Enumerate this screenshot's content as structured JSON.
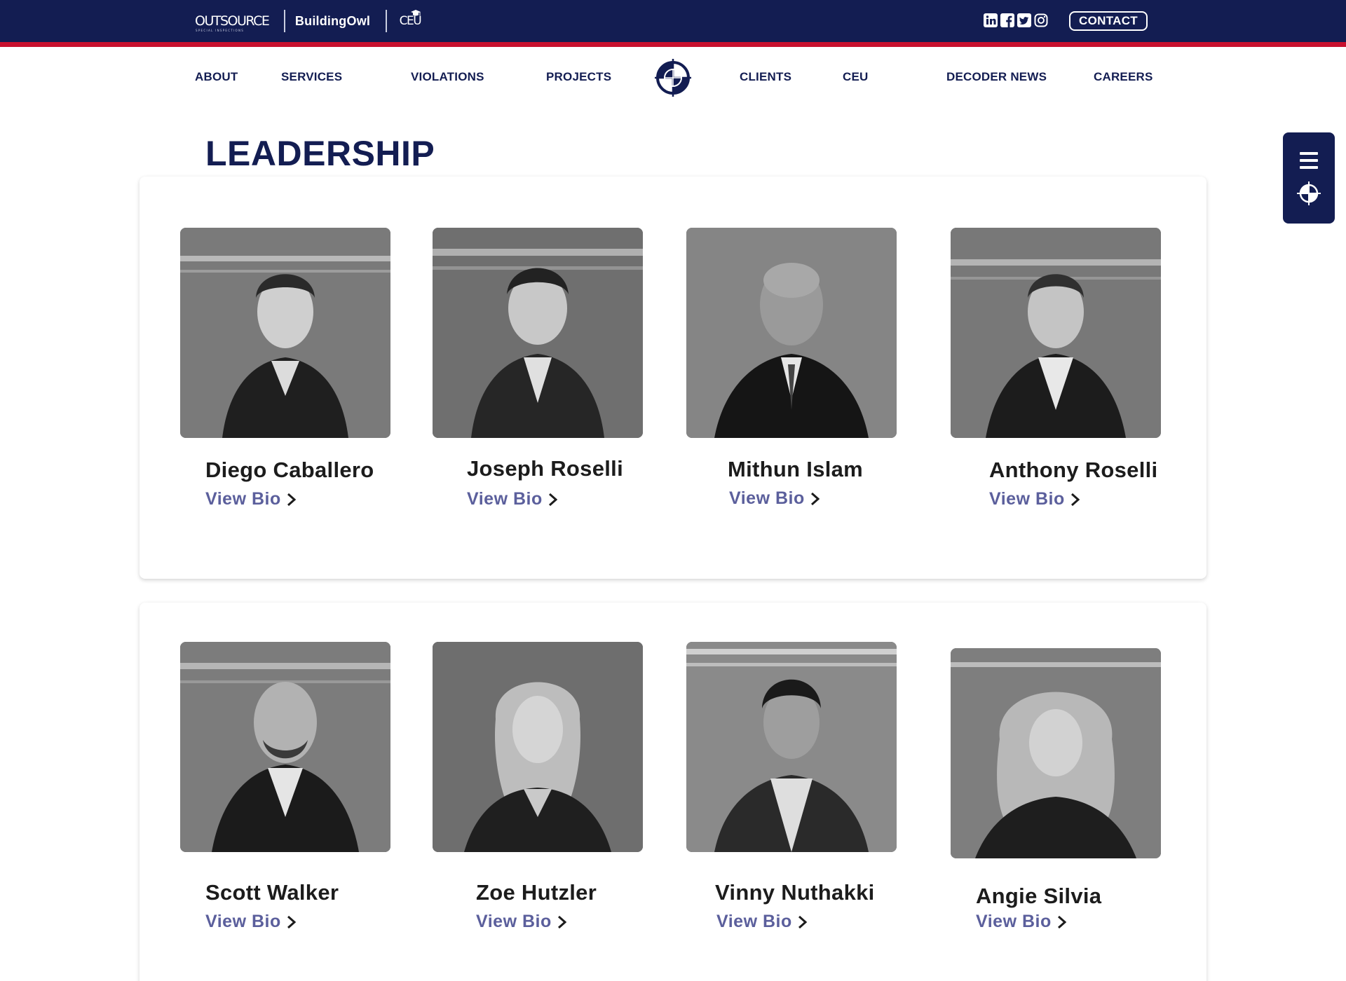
{
  "header": {
    "brands": {
      "outsource": "OUTSOURCE",
      "outsource_sub": "SPECIAL INSPECTIONS",
      "buildingowl": "BuildingOwl",
      "ceu": "CEU"
    },
    "social_icons": [
      "linkedin-icon",
      "facebook-icon",
      "twitter-icon",
      "instagram-icon"
    ],
    "contact_label": "CONTACT"
  },
  "nav": {
    "items": [
      "ABOUT",
      "SERVICES",
      "VIOLATIONS",
      "PROJECTS",
      "CLIENTS",
      "CEU",
      "DECODER NEWS",
      "CAREERS"
    ]
  },
  "page": {
    "title": "LEADERSHIP"
  },
  "leaders": [
    {
      "name": "Diego Caballero",
      "link": "View Bio"
    },
    {
      "name": "Joseph Roselli",
      "link": "View Bio"
    },
    {
      "name": "Mithun Islam",
      "link": "View Bio"
    },
    {
      "name": "Anthony Roselli",
      "link": "View Bio"
    },
    {
      "name": "Scott Walker",
      "link": "View Bio"
    },
    {
      "name": "Zoe Hutzler",
      "link": "View Bio"
    },
    {
      "name": "Vinny Nuthakki",
      "link": "View Bio"
    },
    {
      "name": "Angie Silvia",
      "link": "View Bio"
    }
  ],
  "colors": {
    "navy": "#131d52",
    "red": "#c8102e",
    "link": "#5b5f9c"
  }
}
